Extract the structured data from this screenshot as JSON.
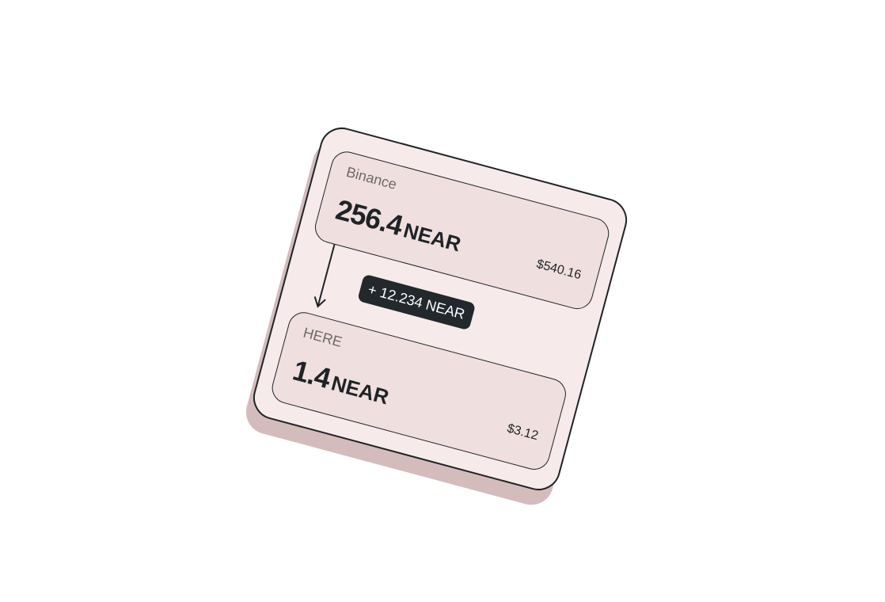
{
  "from_account": {
    "name": "Binance",
    "amount": "256.4",
    "unit": "NEAR",
    "usd": "$540.16"
  },
  "transfer": {
    "delta": "+ 12.234 NEAR"
  },
  "to_account": {
    "name": "HERE",
    "amount": "1.4",
    "unit": "NEAR",
    "usd": "$3.12"
  },
  "icons": {
    "transfer_arrow": "arrow-down-icon"
  },
  "colors": {
    "card_background": "#f6eaea",
    "account_background": "#f0dfdf",
    "shadow": "#d4bcbc",
    "badge_background": "#22282c",
    "ink": "#1f2326"
  }
}
